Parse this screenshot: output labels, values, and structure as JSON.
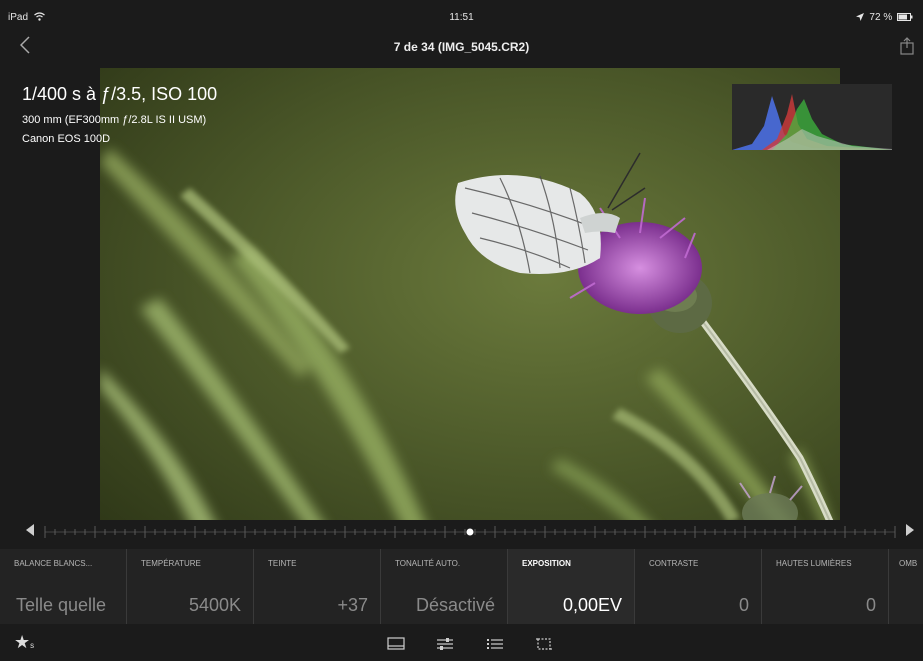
{
  "status_bar": {
    "device": "iPad",
    "wifi_icon": "wifi-icon",
    "time": "11:51",
    "battery": "72 %",
    "location_icon": "location-arrow-icon",
    "battery_icon": "battery-icon"
  },
  "nav": {
    "back_icon": "chevron-left-icon",
    "title": "7 de 34 (IMG_5045.CR2)",
    "share_icon": "share-icon"
  },
  "photo_info": {
    "exposure": "1/400 s à ƒ/3.5, ISO 100",
    "lens": "300 mm (EF300mm ƒ/2.8L IS II USM)",
    "camera": "Canon EOS 100D"
  },
  "histogram": {
    "colors": [
      "#4a6ee0",
      "#d13b3b",
      "#3fbf3f",
      "#cfcfcf"
    ]
  },
  "timeline": {
    "prev_icon": "triangle-left-icon",
    "next_icon": "triangle-right-icon",
    "position": 0.5
  },
  "adjustments": [
    {
      "label": "BALANCE BLANCS...",
      "value": "Telle quelle",
      "active": false
    },
    {
      "label": "TEMPÉRATURE",
      "value": "5400K",
      "active": false
    },
    {
      "label": "TEINTE",
      "value": "+37",
      "active": false
    },
    {
      "label": "TONALITÉ AUTO.",
      "value": "Désactivé",
      "active": false
    },
    {
      "label": "EXPOSITION",
      "value": "0,00EV",
      "active": true
    },
    {
      "label": "CONTRASTE",
      "value": "0",
      "active": false
    },
    {
      "label": "HAUTES LUMIÈRES",
      "value": "0",
      "active": false
    },
    {
      "label": "OMB",
      "value": "",
      "active": false
    }
  ],
  "bottom_bar": {
    "rating_icon": "star-icon",
    "rating_sub": "s",
    "icons": [
      "filmstrip-icon",
      "sliders-icon",
      "list-icon",
      "crop-icon"
    ]
  },
  "colors": {
    "background": "#1b1b1b",
    "toolbar": "#232323",
    "active_text": "#ffffff",
    "inactive_text": "#8a8a8a"
  }
}
